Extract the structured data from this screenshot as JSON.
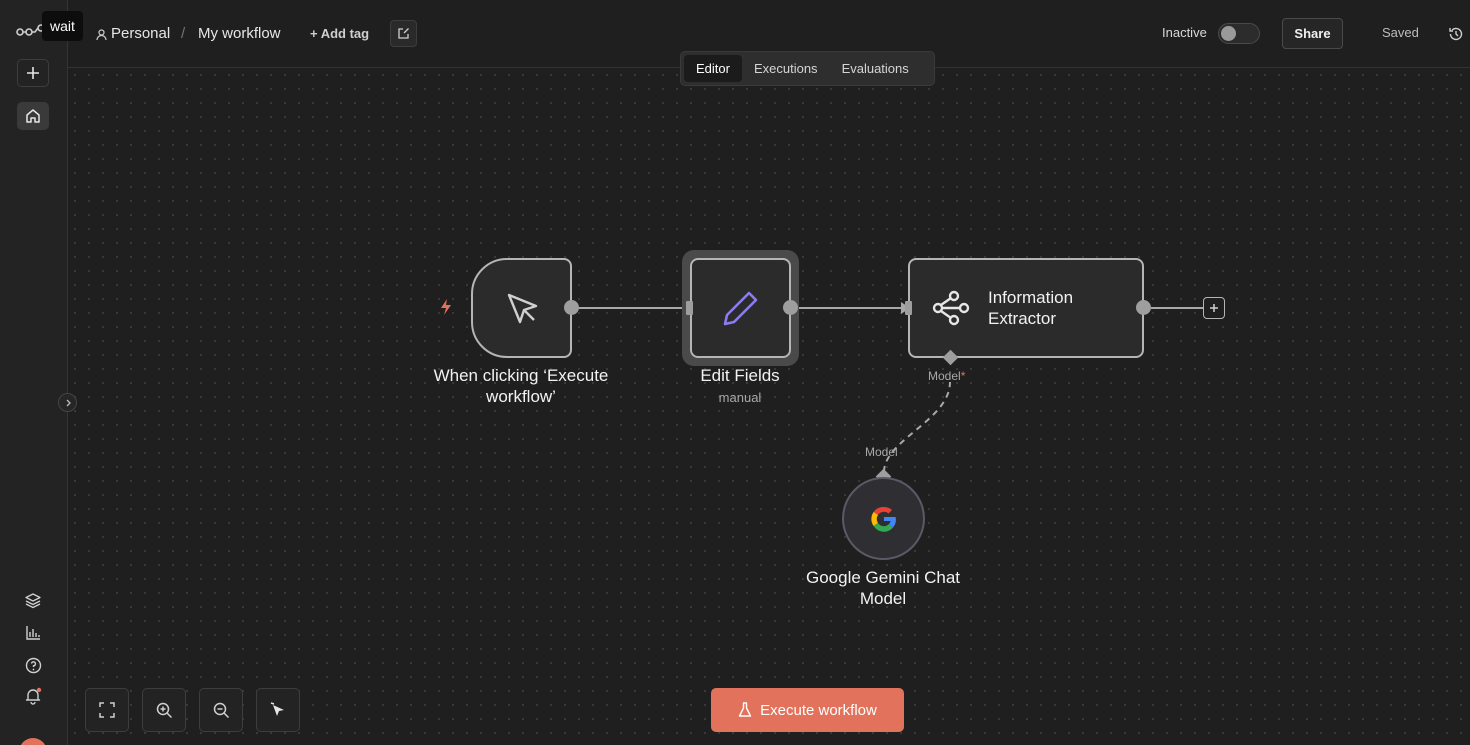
{
  "sidebar": {
    "tooltip": "wait",
    "icons": [
      "n8n-logo-icon",
      "plus-icon",
      "home-icon",
      "templates-icon",
      "insights-icon",
      "help-icon",
      "bell-icon"
    ]
  },
  "header": {
    "project": "Personal",
    "separator": "/",
    "workflow_name": "My workflow",
    "add_tag": "+ Add tag",
    "status_label": "Inactive",
    "share_label": "Share",
    "saved_label": "Saved"
  },
  "tabs": [
    {
      "label": "Editor",
      "active": true
    },
    {
      "label": "Executions",
      "active": false
    },
    {
      "label": "Evaluations",
      "active": false
    }
  ],
  "nodes": {
    "trigger": {
      "label": "When clicking ‘Execute workflow’",
      "icon": "cursor-icon"
    },
    "edit": {
      "label": "Edit Fields",
      "sub": "manual",
      "icon": "pencil-icon"
    },
    "info": {
      "label": "Information Extractor",
      "icon": "extractor-icon"
    },
    "gemini": {
      "label": "Google Gemini Chat Model",
      "icon": "google-icon"
    }
  },
  "ports": {
    "model_required": "Model",
    "model_required_mark": "*",
    "model_output": "Model"
  },
  "footer": {
    "execute_label": "Execute workflow"
  },
  "colors": {
    "accent": "#e2725b",
    "background": "#1f1f1f",
    "node_border": "#b5b5b5",
    "pencil": "#8b7cf0"
  }
}
